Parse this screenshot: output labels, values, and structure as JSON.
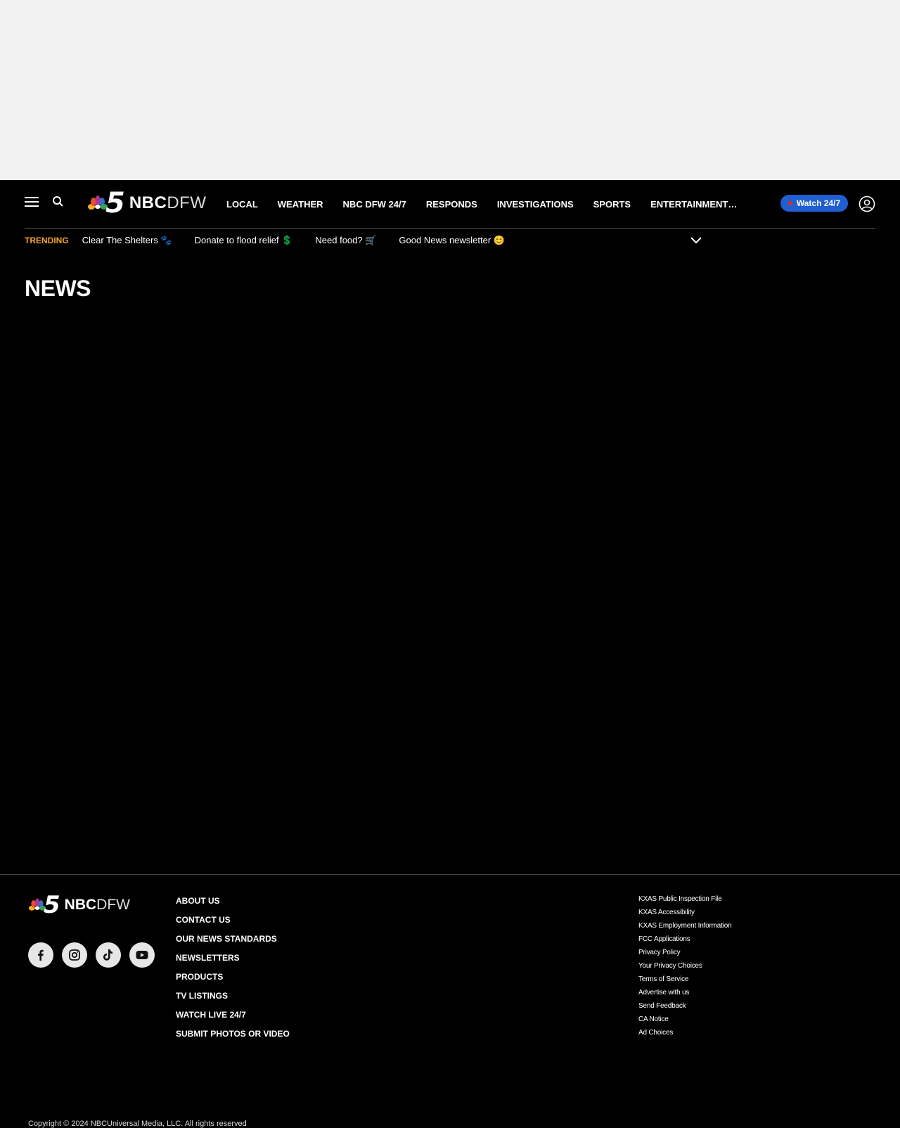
{
  "header": {
    "logo": {
      "number": "5",
      "nbc": "NBC",
      "dfw": "DFW"
    },
    "nav": [
      "LOCAL",
      "WEATHER",
      "NBC DFW 24/7",
      "RESPONDS",
      "INVESTIGATIONS",
      "SPORTS",
      "ENTERTAINMENT…"
    ],
    "watch_label": "Watch 24/7"
  },
  "trending": {
    "label": "TRENDING",
    "items": [
      "Clear The Shelters 🐾",
      "Donate to flood relief 💲",
      "Need food? 🛒",
      "Good News newsletter 😊"
    ]
  },
  "page": {
    "title": "NEWS"
  },
  "footer": {
    "logo": {
      "number": "5",
      "nbc": "NBC",
      "dfw": "DFW"
    },
    "social": [
      "facebook-icon",
      "instagram-icon",
      "tiktok-icon",
      "youtube-icon"
    ],
    "links": [
      "ABOUT US",
      "CONTACT US",
      "OUR NEWS STANDARDS",
      "NEWSLETTERS",
      "PRODUCTS",
      "TV LISTINGS",
      "WATCH LIVE 24/7",
      "SUBMIT PHOTOS OR VIDEO"
    ],
    "legal": [
      "KXAS Public Inspection File",
      "KXAS Accessibility",
      "KXAS Employment Information",
      "FCC Applications",
      "Privacy Policy",
      "Your Privacy Choices",
      "Terms of Service",
      "Advertise with us",
      "Send Feedback",
      "CA Notice",
      "Ad Choices"
    ],
    "copyright": "Copyright © 2024 NBCUniversal Media, LLC. All rights reserved"
  },
  "colors": {
    "trending": "#f4a32a",
    "watch_button": "#1f5fd1",
    "live_dot": "#e0281c",
    "background": "#000000",
    "ad_slot": "#f2f2f2"
  }
}
